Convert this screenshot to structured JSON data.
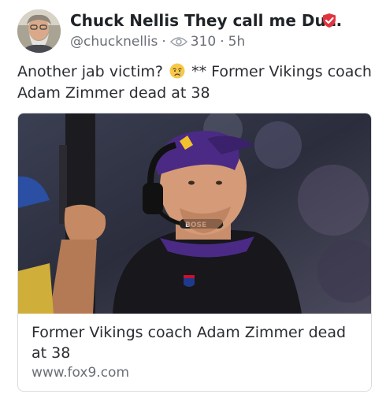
{
  "post": {
    "author_name": "Chuck Nellis They call me Du...",
    "handle": "@chucknellis",
    "separator": "·",
    "views": "310",
    "age": "5h",
    "text_before_emoji": "Another jab victim?",
    "text_after_emoji": "** Former Vikings coach Adam Zimmer dead at 38",
    "emoji": "crying-face-emoji"
  },
  "link_card": {
    "title": "Former Vikings coach Adam Zimmer dead at 38",
    "domain": "www.fox9.com",
    "headset_brand": "BOSE"
  },
  "colors": {
    "verified_badge": "#e03440",
    "meta_text": "#6a6f76",
    "card_border": "#d9dbde",
    "vikings_purple": "#4b2a85"
  }
}
